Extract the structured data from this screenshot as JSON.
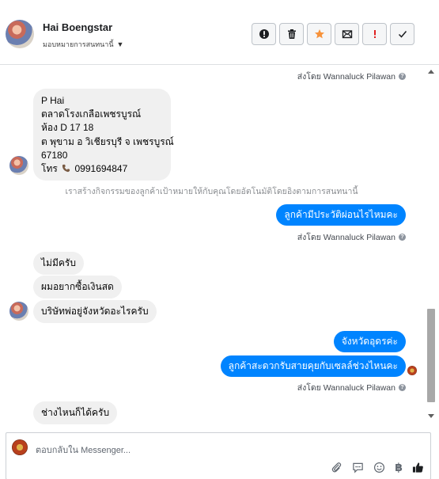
{
  "header": {
    "name": "Hai Boengstar",
    "subtitle": "มอบหมายการสนทนานี้",
    "actions": [
      {
        "name": "report-spam",
        "icon": "exclamation-circle-icon"
      },
      {
        "name": "delete",
        "icon": "trash-icon"
      },
      {
        "name": "star",
        "icon": "star-icon"
      },
      {
        "name": "mark-unread",
        "icon": "envelope-icon"
      },
      {
        "name": "mark-important",
        "icon": "exclamation-icon"
      },
      {
        "name": "mark-done",
        "icon": "checkmark-icon"
      }
    ],
    "colors": {
      "star": "#f7923a",
      "important": "#e02020"
    }
  },
  "messages": {
    "sent_by_1": "ส่งโดย Wannaluck Pilawan",
    "address_lines": [
      "P Hai",
      "ตลาดโรงเกลือเพชรบูรณ์",
      "ห้อง D 17 18",
      "ต พุขาม อ วิเชียรบุรี จ เพชรบูรณ์",
      "67180"
    ],
    "phone_prefix": "โทร",
    "phone_number": "0991694847",
    "notice": "เราสร้างกิจกรรมของลูกค้าเป้าหมายให้กับคุณโดยอัตโนมัติโดยอิงตามการสนทนานี้",
    "out_1": "ลูกค้ามีประวัติผ่อนไรไหมคะ",
    "sent_by_2": "ส่งโดย Wannaluck Pilawan",
    "in_1": "ไม่มีครับ",
    "in_2": "ผมอยากซื้อเงินสด",
    "in_3": "บริษัทพ่อยู่จังหวัดอะไรครับ",
    "out_2": "จังหวัดอุดรค่ะ",
    "out_3": "ลูกค้าสะดวกรับสายคุยกับเซลล์ช่วงไหนคะ",
    "sent_by_3": "ส่งโดย Wannaluck Pilawan",
    "in_4": "ช่างไหนก็ได้ครับ"
  },
  "composer": {
    "placeholder": "ตอบกลับใน Messenger...",
    "tools": [
      "attach-icon",
      "chat-bubble-icon",
      "emoji-icon",
      "baht-icon",
      "thumbs-up-icon"
    ],
    "baht_symbol": "฿"
  },
  "colors": {
    "outgoing_bubble": "#0084ff",
    "incoming_bubble": "#f0f0f0"
  }
}
